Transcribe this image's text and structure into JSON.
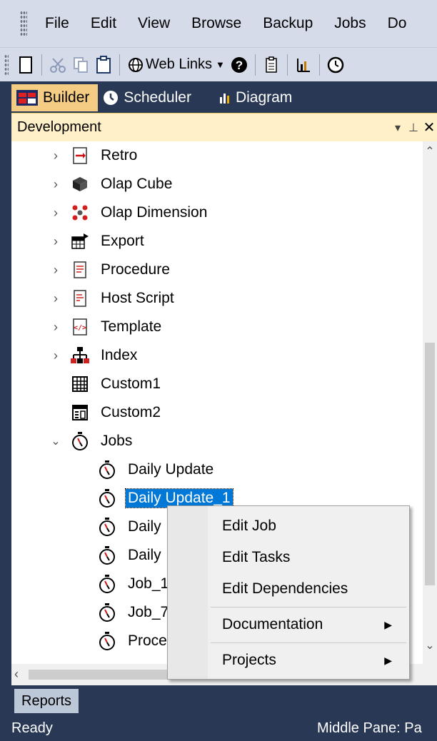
{
  "menubar": {
    "items": [
      "File",
      "Edit",
      "View",
      "Browse",
      "Backup",
      "Jobs",
      "Do"
    ]
  },
  "toolbar": {
    "weblinks_label": "Web Links"
  },
  "tabs": [
    {
      "label": "Builder",
      "active": true,
      "icon": "builder-icon"
    },
    {
      "label": "Scheduler",
      "active": false,
      "icon": "clock-icon"
    },
    {
      "label": "Diagram",
      "active": false,
      "icon": "bar-chart-icon"
    }
  ],
  "panel": {
    "title": "Development",
    "controls": [
      "▾",
      "⊥",
      "✕"
    ]
  },
  "tree": {
    "items": [
      {
        "label": "Retro",
        "icon": "retro-icon",
        "expandable": true,
        "expanded": false,
        "level": 0
      },
      {
        "label": "Olap Cube",
        "icon": "cube-icon",
        "expandable": true,
        "expanded": false,
        "level": 0
      },
      {
        "label": "Olap Dimension",
        "icon": "dimension-icon",
        "expandable": true,
        "expanded": false,
        "level": 0
      },
      {
        "label": "Export",
        "icon": "export-icon",
        "expandable": true,
        "expanded": false,
        "level": 0
      },
      {
        "label": "Procedure",
        "icon": "procedure-icon",
        "expandable": true,
        "expanded": false,
        "level": 0
      },
      {
        "label": "Host Script",
        "icon": "script-icon",
        "expandable": true,
        "expanded": false,
        "level": 0
      },
      {
        "label": "Template",
        "icon": "template-icon",
        "expandable": true,
        "expanded": false,
        "level": 0
      },
      {
        "label": "Index",
        "icon": "index-icon",
        "expandable": true,
        "expanded": false,
        "level": 0
      },
      {
        "label": "Custom1",
        "icon": "grid-icon",
        "expandable": false,
        "expanded": false,
        "level": 0
      },
      {
        "label": "Custom2",
        "icon": "form-icon",
        "expandable": false,
        "expanded": false,
        "level": 0
      },
      {
        "label": "Jobs",
        "icon": "stopwatch-icon",
        "expandable": true,
        "expanded": true,
        "level": 0
      },
      {
        "label": "Daily Update",
        "icon": "stopwatch-icon",
        "level": 1
      },
      {
        "label": "Daily Update_1",
        "icon": "stopwatch-icon",
        "level": 1,
        "selected": true
      },
      {
        "label": "Daily",
        "icon": "stopwatch-icon",
        "level": 1
      },
      {
        "label": "Daily",
        "icon": "stopwatch-icon",
        "level": 1
      },
      {
        "label": "Job_1",
        "icon": "stopwatch-icon",
        "level": 1
      },
      {
        "label": "Job_7",
        "icon": "stopwatch-icon",
        "level": 1
      },
      {
        "label": "Proce",
        "icon": "stopwatch-icon",
        "level": 1
      }
    ]
  },
  "context_menu": {
    "items": [
      {
        "label": "Edit Job",
        "submenu": false
      },
      {
        "label": "Edit Tasks",
        "submenu": false
      },
      {
        "label": "Edit Dependencies",
        "submenu": false
      },
      {
        "label": "Documentation",
        "submenu": true
      },
      {
        "label": "Projects",
        "submenu": true
      }
    ],
    "submenu_arrow": "▶"
  },
  "bottom_tabs": {
    "reports_label": "Reports"
  },
  "status": {
    "left": "Ready",
    "right": "Middle Pane: Pa"
  },
  "colors": {
    "frame": "#293955",
    "active_tab": "#f5cc84",
    "panel_header": "#fff0c8",
    "selection": "#0078d7"
  }
}
